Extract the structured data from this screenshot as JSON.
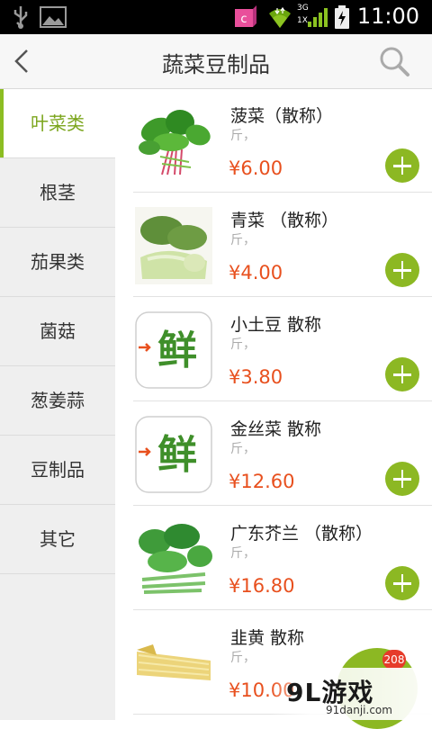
{
  "status_bar": {
    "time": "11:00",
    "network": "3G",
    "network_sub": "1X"
  },
  "header": {
    "title": "蔬菜豆制品"
  },
  "sidebar": {
    "items": [
      {
        "label": "叶菜类",
        "active": true
      },
      {
        "label": "根茎",
        "active": false
      },
      {
        "label": "茄果类",
        "active": false
      },
      {
        "label": "菌菇",
        "active": false
      },
      {
        "label": "葱姜蒜",
        "active": false
      },
      {
        "label": "豆制品",
        "active": false
      },
      {
        "label": "其它",
        "active": false
      }
    ]
  },
  "products": [
    {
      "name": "菠菜（散称）",
      "unit": "斤，",
      "price": "¥6.00",
      "image": "spinach-image"
    },
    {
      "name": "青菜 （散称）",
      "unit": "斤，",
      "price": "¥4.00",
      "image": "bok-choy-image"
    },
    {
      "name": "小土豆 散称",
      "unit": "斤，",
      "price": "¥3.80",
      "image": "fresh-logo-image",
      "logo_text": "鲜"
    },
    {
      "name": "金丝菜 散称",
      "unit": "斤，",
      "price": "¥12.60",
      "image": "fresh-logo-image",
      "logo_text": "鲜"
    },
    {
      "name": "广东芥兰 （散称）",
      "unit": "斤，",
      "price": "¥16.80",
      "image": "kale-image"
    },
    {
      "name": "韭黄 散称",
      "unit": "斤，",
      "price": "¥10.00",
      "image": "yellow-chive-image"
    }
  ],
  "cart": {
    "badge": "208"
  },
  "watermark": {
    "logo": "9L游戏",
    "url": "91danji.com"
  },
  "colors": {
    "accent_green": "#8cb823",
    "price_red": "#e8501e",
    "badge_red": "#e63b2a"
  }
}
